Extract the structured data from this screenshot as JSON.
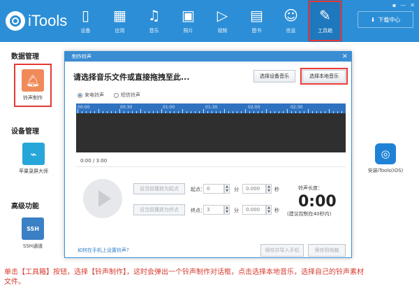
{
  "app": {
    "title": "iTools"
  },
  "window_controls": [
    "▪",
    "—",
    "✕"
  ],
  "nav": [
    {
      "label": "设备",
      "icon": "device-icon",
      "glyph": "▯"
    },
    {
      "label": "应用",
      "icon": "apps-icon",
      "glyph": "▦"
    },
    {
      "label": "音乐",
      "icon": "music-icon",
      "glyph": "♫"
    },
    {
      "label": "照片",
      "icon": "photo-icon",
      "glyph": "▣"
    },
    {
      "label": "视频",
      "icon": "video-icon",
      "glyph": "▷"
    },
    {
      "label": "图书",
      "icon": "book-icon",
      "glyph": "▤"
    },
    {
      "label": "信息",
      "icon": "user-icon",
      "glyph": "☺"
    },
    {
      "label": "工具箱",
      "icon": "wrench-icon",
      "glyph": "✎"
    }
  ],
  "download": {
    "label": "下载中心",
    "icon": "download-icon"
  },
  "sections": {
    "data": "数据管理",
    "device": "设备管理",
    "advanced": "高级功能"
  },
  "tools": {
    "ringtone": "铃声制作",
    "screen": "苹果录屏大师",
    "ssh": "SSH通道",
    "ios": "安装iTools(iOS)"
  },
  "dialog": {
    "title": "制作铃声",
    "close": "×",
    "heading": "请选择音乐文件或直接拖拽至此...",
    "btn_device": "选择设备音乐",
    "btn_local": "选择本地音乐",
    "radio_ringtone": "来电铃声",
    "radio_sms": "短信铃声",
    "time": "0:00 / 3:00",
    "btn_set_start": "设当前播放为起点",
    "btn_set_end": "设当前播放为终点",
    "start_label": "起点：",
    "end_label": "终点：",
    "start_min": "0",
    "start_sec": "0.000",
    "end_min": "3",
    "end_sec": "0.000",
    "min_unit": "分",
    "sec_unit": "秒",
    "len_label": "铃声长度：",
    "len_value": "0:00",
    "len_hint": "(建议控制在40秒内)",
    "help": "如何在手机上设置铃声?",
    "btn_save_import": "保存并导入手机",
    "btn_save_pc": "保存到电脑"
  },
  "ruler_ticks": [
    "00:00",
    "00:30",
    "01:00",
    "01:30",
    "02:00",
    "02:30"
  ],
  "caption_line1": "单击【工具箱】按钮，选择【铃声制作】，这时会弹出一个铃声制作对话框，点击选择本地音乐，选择自己的铃声素材",
  "caption_line2": "文件。"
}
